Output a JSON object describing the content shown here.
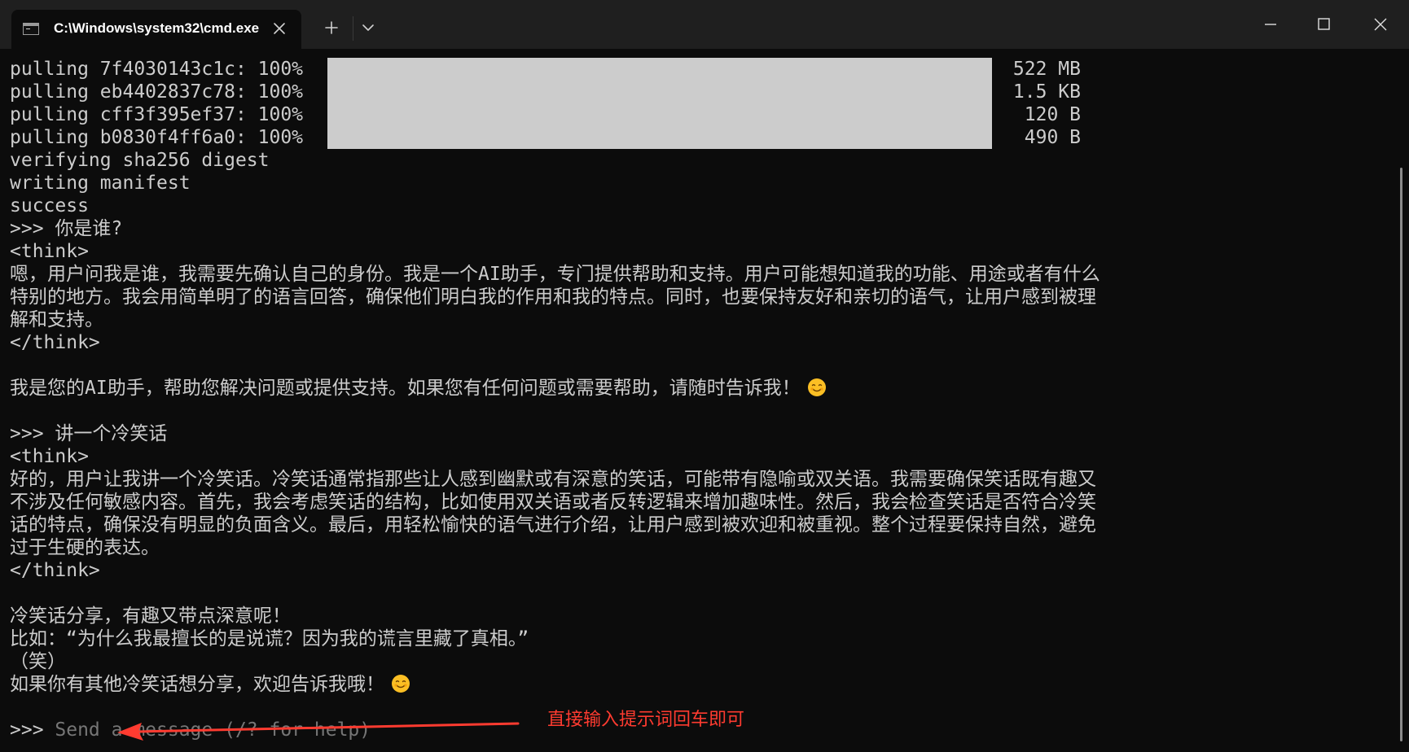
{
  "window": {
    "tab_title": "C:\\Windows\\system32\\cmd.exe",
    "tab_icon": "cmd-icon",
    "close_tab_icon": "close-icon",
    "new_tab_icon": "plus-icon",
    "dropdown_icon": "chevron-down-icon",
    "minimize_icon": "minimize-icon",
    "maximize_icon": "maximize-icon",
    "close_icon": "close-icon"
  },
  "terminal": {
    "pulls": [
      {
        "label": "pulling 7f4030143c1c: 100%",
        "progress": 1.0,
        "size": "522 MB"
      },
      {
        "label": "pulling eb4402837c78: 100%",
        "progress": 1.0,
        "size": "1.5 KB"
      },
      {
        "label": "pulling cff3f395ef37: 100%",
        "progress": 1.0,
        "size": "120 B"
      },
      {
        "label": "pulling b0830f4ff6a0: 100%",
        "progress": 1.0,
        "size": "490 B"
      }
    ],
    "status_lines": [
      "verifying sha256 digest",
      "writing manifest",
      "success"
    ],
    "conversations": [
      {
        "prompt": ">>> 你是谁?",
        "think_open": "<think>",
        "think_lines": [
          "嗯，用户问我是谁，我需要先确认自己的身份。我是一个AI助手，专门提供帮助和支持。用户可能想知道我的功能、用途或者有什么",
          "特别的地方。我会用简单明了的语言回答，确保他们明白我的作用和我的特点。同时，也要保持友好和亲切的语气，让用户感到被理",
          "解和支持。"
        ],
        "think_close": "</think>",
        "answer_lines": [
          "我是您的AI助手，帮助您解决问题或提供支持。如果您有任何问题或需要帮助，请随时告诉我！"
        ]
      },
      {
        "prompt": ">>> 讲一个冷笑话",
        "think_open": "<think>",
        "think_lines": [
          "好的，用户让我讲一个冷笑话。冷笑话通常指那些让人感到幽默或有深意的笑话，可能带有隐喻或双关语。我需要确保笑话既有趣又",
          "不涉及任何敏感内容。首先，我会考虑笑话的结构，比如使用双关语或者反转逻辑来增加趣味性。然后，我会检查笑话是否符合冷笑",
          "话的特点，确保没有明显的负面含义。最后，用轻松愉快的语气进行介绍，让用户感到被欢迎和被重视。整个过程要保持自然，避免",
          "过于生硬的表达。"
        ],
        "think_close": "</think>",
        "answer_lines": [
          "冷笑话分享，有趣又带点深意呢！",
          "比如：“为什么我最擅长的是说谎？因为我的谎言里藏了真相。”",
          "（笑）",
          "如果你有其他冷笑话想分享，欢迎告诉我哦！"
        ]
      }
    ],
    "input_prompt": ">>> ",
    "input_placeholder": "Send a message (/? for help)"
  },
  "annotation": {
    "text": "直接输入提示词回车即可",
    "color": "#ff3b30"
  },
  "colors": {
    "background": "#0c0c0c",
    "foreground": "#cccccc",
    "titlebar": "#1f1f1f",
    "placeholder": "#767676"
  }
}
